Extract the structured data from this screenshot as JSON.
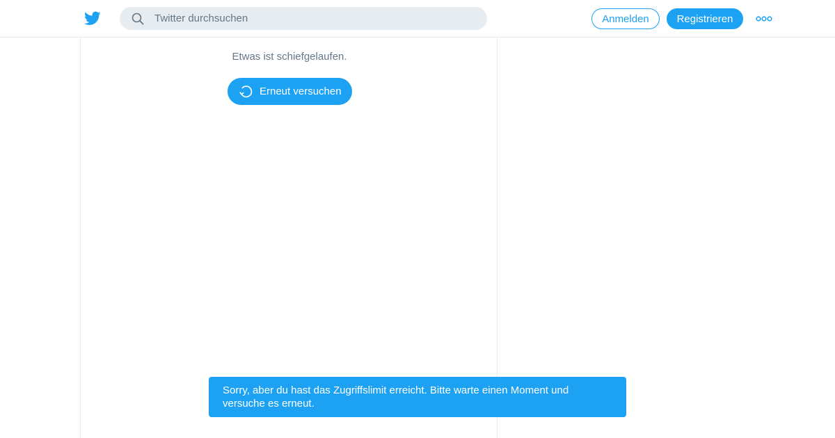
{
  "header": {
    "logo_icon": "twitter-bird-icon",
    "search": {
      "placeholder": "Twitter durchsuchen",
      "value": "",
      "icon": "search-icon"
    },
    "login_label": "Anmelden",
    "register_label": "Registrieren",
    "more_icon": "more-icon"
  },
  "main": {
    "error_message": "Etwas ist schiefgelaufen.",
    "retry_label": "Erneut versuchen",
    "retry_icon": "refresh-icon"
  },
  "toast": {
    "message": "Sorry, aber du hast das Zugriffslimit erreicht. Bitte warte einen Moment und versuche es erneut."
  },
  "colors": {
    "accent": "#1da1f2",
    "search_bg": "#e6ecf0",
    "muted_text": "#657786",
    "divider": "#e6ecf0"
  }
}
